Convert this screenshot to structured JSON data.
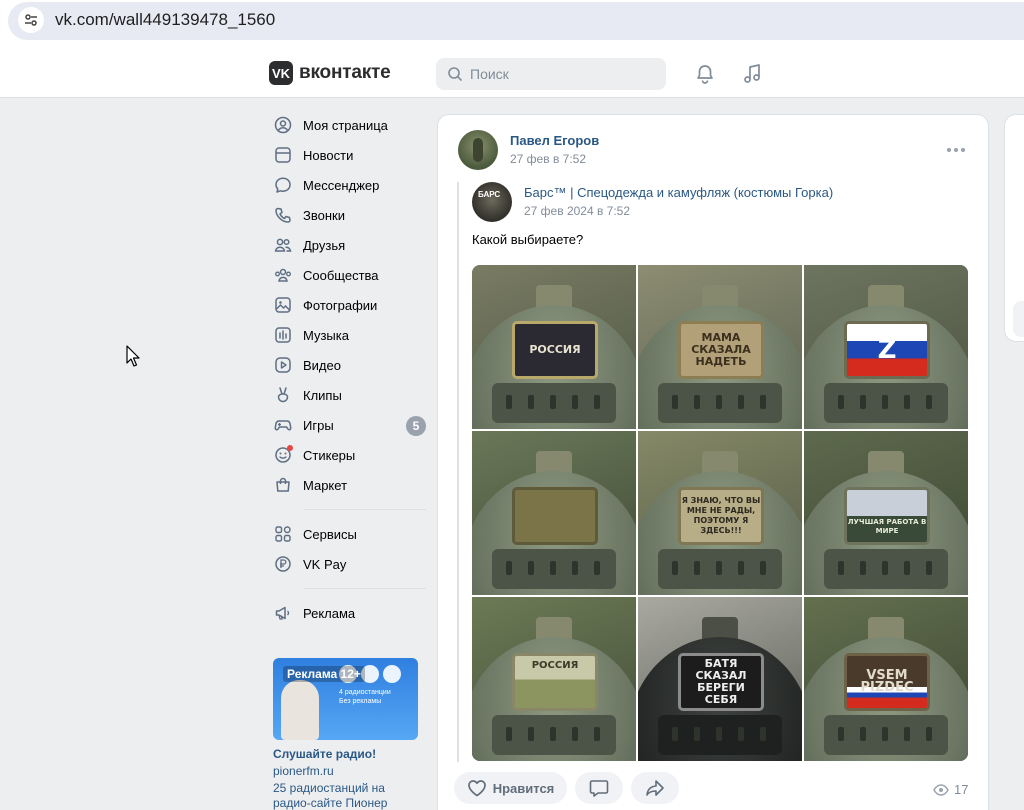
{
  "browser": {
    "url": "vk.com/wall449139478_1560"
  },
  "header": {
    "logo_mark": "VK",
    "logo_text": "вконтакте",
    "search_placeholder": "Поиск"
  },
  "menu": {
    "items": [
      {
        "label": "Моя страница",
        "icon": "user-circle-icon"
      },
      {
        "label": "Новости",
        "icon": "news-icon"
      },
      {
        "label": "Мессенджер",
        "icon": "message-icon"
      },
      {
        "label": "Звонки",
        "icon": "phone-icon"
      },
      {
        "label": "Друзья",
        "icon": "friends-icon"
      },
      {
        "label": "Сообщества",
        "icon": "communities-icon"
      },
      {
        "label": "Фотографии",
        "icon": "photo-icon"
      },
      {
        "label": "Музыка",
        "icon": "music-icon"
      },
      {
        "label": "Видео",
        "icon": "video-icon"
      },
      {
        "label": "Клипы",
        "icon": "clips-icon"
      },
      {
        "label": "Игры",
        "icon": "games-icon",
        "badge": "5"
      },
      {
        "label": "Стикеры",
        "icon": "stickers-icon"
      },
      {
        "label": "Маркет",
        "icon": "market-icon"
      }
    ],
    "items2": [
      {
        "label": "Сервисы",
        "icon": "services-icon"
      },
      {
        "label": "VK Pay",
        "icon": "vkpay-icon"
      }
    ],
    "items3": [
      {
        "label": "Реклама",
        "icon": "megaphone-icon"
      }
    ]
  },
  "ad": {
    "label": "Реклама 12+",
    "image_text": "4 радиостанции Без рекламы",
    "title": "Слушайте радио!",
    "site": "pionerfm.ru",
    "description": "25 радиостанций на радио-сайте Пионер"
  },
  "post": {
    "author": "Павел Егоров",
    "date": "27 фев в 7:52",
    "source_name": "Барс™ | Спецодежда и камуфляж (костюмы Горка)",
    "source_date": "27 фев 2024 в 7:52",
    "text": "Какой выбираете?",
    "photos": [
      {
        "caption": "РОССИЯ",
        "style": "dark"
      },
      {
        "caption": "МАМА СКАЗАЛА НАДЕТЬ",
        "style": "tan"
      },
      {
        "caption": "Z",
        "style": "flag"
      },
      {
        "caption": "",
        "style": "olive"
      },
      {
        "caption": "Я ЗНАЮ, ЧТО ВЫ МНЕ НЕ РАДЫ, ПОЭТОМУ Я ЗДЕСЬ!!!",
        "style": "khaki"
      },
      {
        "caption": "ЛУЧШАЯ РАБОТА В МИРЕ",
        "style": "scene"
      },
      {
        "caption": "РОССИЯ",
        "style": "green"
      },
      {
        "caption": "БАТЯ СКАЗАЛ БЕРЕГИ СЕБЯ",
        "style": "black"
      },
      {
        "caption": "VSEM PIZDEC",
        "style": "brown"
      }
    ],
    "like_label": "Нравится",
    "views": "17"
  },
  "colors": {
    "link": "#2a5885",
    "muted": "#818c99",
    "bg": "#edeef0"
  }
}
